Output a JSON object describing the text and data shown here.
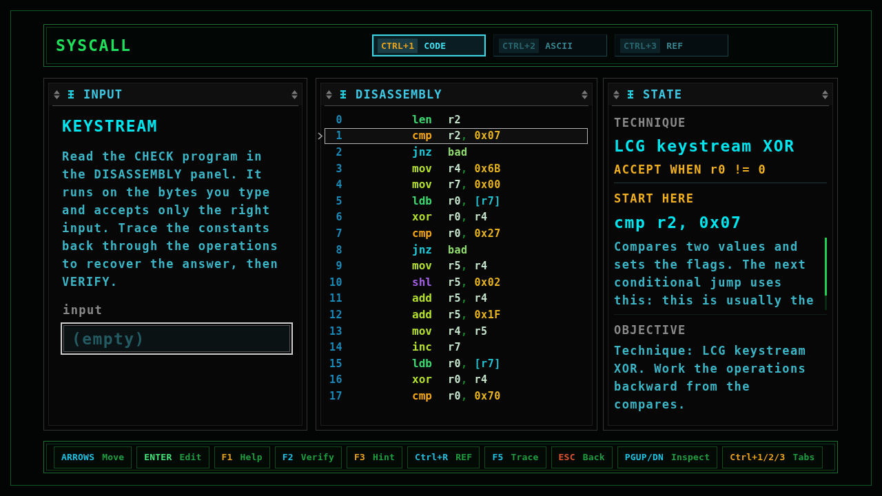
{
  "app_title": "SYSCALL",
  "tabs": [
    {
      "key": "CTRL+1",
      "label": "CODE",
      "selected": true
    },
    {
      "key": "CTRL+2",
      "label": "ASCII",
      "selected": false
    },
    {
      "key": "CTRL+3",
      "label": "REF",
      "selected": false
    }
  ],
  "panels": [
    {
      "kind": "input",
      "title": "INPUT",
      "heading": "KEYSTREAM",
      "text": "Read the CHECK program in the DISASSEMBLY panel. It runs on the bytes you type and accepts only the right input. Trace the constants back through the operations to recover the answer, then VERIFY.",
      "field": {
        "label": "input",
        "placeholder": "(empty)"
      }
    },
    {
      "kind": "disassembly",
      "title": "DISASSEMBLY",
      "instructions": [
        {
          "line": "0",
          "mnemonic": "len",
          "color": "#3cd870",
          "selected": false,
          "operands": [
            {
              "text": "r2",
              "kind": "register"
            }
          ]
        },
        {
          "line": "1",
          "mnemonic": "cmp",
          "color": "#f0a418",
          "selected": true,
          "operands": [
            {
              "text": "r2",
              "kind": "register"
            },
            {
              "text": ",",
              "kind": "separator"
            },
            {
              "text": "0x07",
              "kind": "immediate"
            }
          ]
        },
        {
          "line": "2",
          "mnemonic": "jnz",
          "color": "#20c8d8",
          "selected": false,
          "operands": [
            {
              "text": "bad",
              "kind": "label"
            }
          ]
        },
        {
          "line": "3",
          "mnemonic": "mov",
          "color": "#b4e030",
          "selected": false,
          "operands": [
            {
              "text": "r4",
              "kind": "register"
            },
            {
              "text": ",",
              "kind": "separator"
            },
            {
              "text": "0x6B",
              "kind": "immediate"
            }
          ]
        },
        {
          "line": "4",
          "mnemonic": "mov",
          "color": "#b4e030",
          "selected": false,
          "operands": [
            {
              "text": "r7",
              "kind": "register"
            },
            {
              "text": ",",
              "kind": "separator"
            },
            {
              "text": "0x00",
              "kind": "immediate"
            }
          ]
        },
        {
          "line": "5",
          "mnemonic": "ldb",
          "color": "#3cd870",
          "selected": false,
          "operands": [
            {
              "text": "r0",
              "kind": "register"
            },
            {
              "text": ",",
              "kind": "separator"
            },
            {
              "text": "[r7]",
              "kind": "memory"
            }
          ]
        },
        {
          "line": "6",
          "mnemonic": "xor",
          "color": "#b4e030",
          "selected": false,
          "operands": [
            {
              "text": "r0",
              "kind": "register"
            },
            {
              "text": ",",
              "kind": "separator"
            },
            {
              "text": "r4",
              "kind": "register"
            }
          ]
        },
        {
          "line": "7",
          "mnemonic": "cmp",
          "color": "#f0a418",
          "selected": false,
          "operands": [
            {
              "text": "r0",
              "kind": "register"
            },
            {
              "text": ",",
              "kind": "separator"
            },
            {
              "text": "0x27",
              "kind": "immediate"
            }
          ]
        },
        {
          "line": "8",
          "mnemonic": "jnz",
          "color": "#20c8d8",
          "selected": false,
          "operands": [
            {
              "text": "bad",
              "kind": "label"
            }
          ]
        },
        {
          "line": "9",
          "mnemonic": "mov",
          "color": "#b4e030",
          "selected": false,
          "operands": [
            {
              "text": "r5",
              "kind": "register"
            },
            {
              "text": ",",
              "kind": "separator"
            },
            {
              "text": "r4",
              "kind": "register"
            }
          ]
        },
        {
          "line": "10",
          "mnemonic": "shl",
          "color": "#a060e0",
          "selected": false,
          "operands": [
            {
              "text": "r5",
              "kind": "register"
            },
            {
              "text": ",",
              "kind": "separator"
            },
            {
              "text": "0x02",
              "kind": "immediate"
            }
          ]
        },
        {
          "line": "11",
          "mnemonic": "add",
          "color": "#b4e030",
          "selected": false,
          "operands": [
            {
              "text": "r5",
              "kind": "register"
            },
            {
              "text": ",",
              "kind": "separator"
            },
            {
              "text": "r4",
              "kind": "register"
            }
          ]
        },
        {
          "line": "12",
          "mnemonic": "add",
          "color": "#b4e030",
          "selected": false,
          "operands": [
            {
              "text": "r5",
              "kind": "register"
            },
            {
              "text": ",",
              "kind": "separator"
            },
            {
              "text": "0x1F",
              "kind": "immediate"
            }
          ]
        },
        {
          "line": "13",
          "mnemonic": "mov",
          "color": "#b4e030",
          "selected": false,
          "operands": [
            {
              "text": "r4",
              "kind": "register"
            },
            {
              "text": ",",
              "kind": "separator"
            },
            {
              "text": "r5",
              "kind": "register"
            }
          ]
        },
        {
          "line": "14",
          "mnemonic": "inc",
          "color": "#b4e030",
          "selected": false,
          "operands": [
            {
              "text": "r7",
              "kind": "register"
            }
          ]
        },
        {
          "line": "15",
          "mnemonic": "ldb",
          "color": "#3cd870",
          "selected": false,
          "operands": [
            {
              "text": "r0",
              "kind": "register"
            },
            {
              "text": ",",
              "kind": "separator"
            },
            {
              "text": "[r7]",
              "kind": "memory"
            }
          ]
        },
        {
          "line": "16",
          "mnemonic": "xor",
          "color": "#b4e030",
          "selected": false,
          "operands": [
            {
              "text": "r0",
              "kind": "register"
            },
            {
              "text": ",",
              "kind": "separator"
            },
            {
              "text": "r4",
              "kind": "register"
            }
          ]
        },
        {
          "line": "17",
          "mnemonic": "cmp",
          "color": "#f0a418",
          "selected": false,
          "operands": [
            {
              "text": "r0",
              "kind": "register"
            },
            {
              "text": ",",
              "kind": "separator"
            },
            {
              "text": "0x70",
              "kind": "immediate"
            }
          ]
        }
      ]
    },
    {
      "kind": "state",
      "title": "STATE",
      "technique_label": "TECHNIQUE",
      "technique": "LCG keystream XOR",
      "accept": "ACCEPT WHEN r0 != 0",
      "start_label": "START HERE",
      "start_instruction": "cmp r2, 0x07",
      "explanation": "Compares two values and sets the flags. The next conditional jump uses this: this is usually the",
      "objective_label": "OBJECTIVE",
      "objective": "Technique: LCG keystream XOR. Work the operations backward from the compares."
    }
  ],
  "key_hints": [
    {
      "key": "ARROWS",
      "action": "Move",
      "color": "#22c0e0"
    },
    {
      "key": "ENTER",
      "action": "Edit",
      "color": "#44e27a"
    },
    {
      "key": "F1",
      "action": "Help",
      "color": "#e8a020"
    },
    {
      "key": "F2",
      "action": "Verify",
      "color": "#22c0e0"
    },
    {
      "key": "F3",
      "action": "Hint",
      "color": "#e8a020"
    },
    {
      "key": "Ctrl+R",
      "action": "REF",
      "color": "#22c0e0"
    },
    {
      "key": "F5",
      "action": "Trace",
      "color": "#22c0e0"
    },
    {
      "key": "ESC",
      "action": "Back",
      "color": "#e05530"
    },
    {
      "key": "PGUP/DN",
      "action": "Inspect",
      "color": "#22c0e0"
    },
    {
      "key": "Ctrl+1/2/3",
      "action": "Tabs",
      "color": "#e8a020"
    }
  ]
}
